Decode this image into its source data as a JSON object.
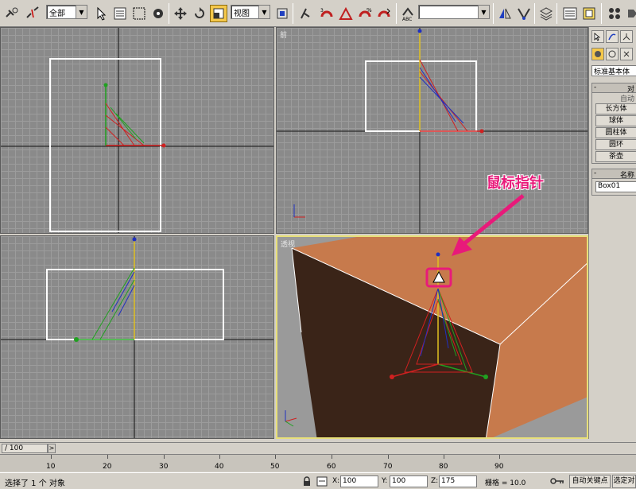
{
  "toolbar": {
    "selection_filter": "全部",
    "reference_coord": "视图",
    "named_selection": ""
  },
  "viewports": {
    "front_label": "前",
    "perspective_label": "透视"
  },
  "command_panel": {
    "category_dropdown": "标准基本体",
    "rollout_object_type": "对",
    "autogrid": "自动",
    "buttons": [
      "长方体",
      "球体",
      "圆柱体",
      "圆环",
      "茶壶"
    ],
    "rollout_name": "名称",
    "object_name": "Box01"
  },
  "annotation": {
    "text": "鼠标指针",
    "color": "#e81a7a"
  },
  "timeline": {
    "slider_label": "/ 100",
    "ticks": [
      "10",
      "20",
      "30",
      "40",
      "50",
      "60",
      "70",
      "80",
      "90"
    ]
  },
  "status": {
    "selection_text": "选择了 1 个 对象",
    "x_value": "100",
    "y_value": "100",
    "z_value": "175",
    "grid_text": "栅格 = 10.0",
    "auto_key": "自动关键点",
    "set_key": "选定对"
  },
  "colors": {
    "box_top": "#c77a4c",
    "box_front": "#3a2418",
    "axis_x": "#d02020",
    "axis_y": "#20a020",
    "axis_z": "#2030c0"
  }
}
